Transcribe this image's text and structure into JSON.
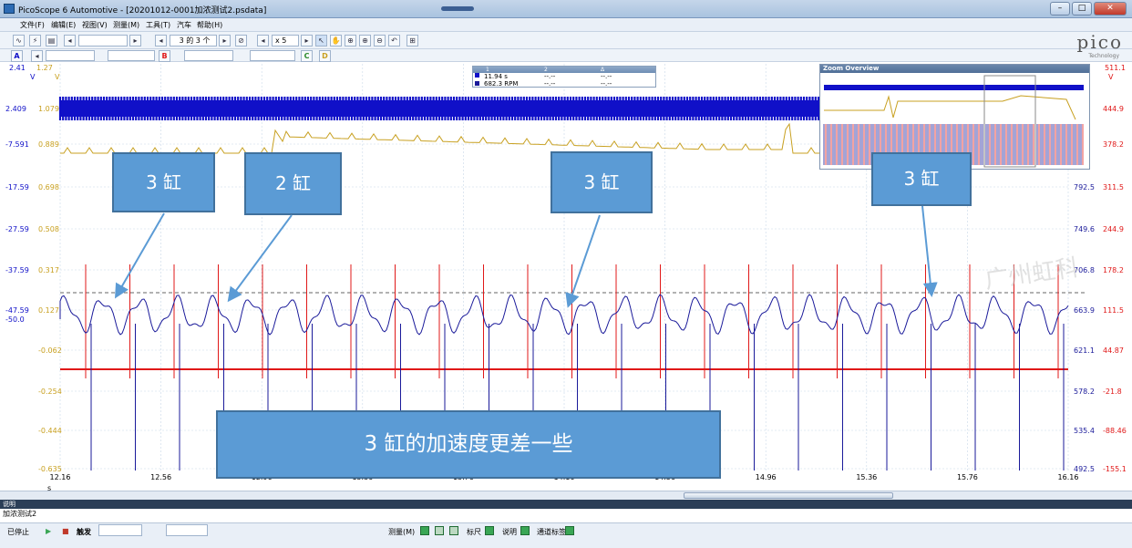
{
  "window": {
    "title": "PicoScope 6 Automotive - [20201012-0001加浓测试2.psdata]",
    "min_label": "–",
    "max_label": "□",
    "close_label": "✕"
  },
  "menu": [
    "文件(F)",
    "编辑(E)",
    "视图(V)",
    "测量(M)",
    "工具(T)",
    "汽车",
    "帮助(H)"
  ],
  "toolbar1": {
    "buffer_label": "3 的 3 个",
    "zoom_label": "x 5"
  },
  "toolbar2": {
    "channel_a": "A",
    "channel_b": "B",
    "channel_c": "C",
    "channel_d": "D"
  },
  "logo": {
    "text": "pico",
    "sub": "Technology"
  },
  "left_axis_header": {
    "a": "2.41",
    "b": "1.27",
    "unit_a": "V",
    "unit_b": "V"
  },
  "left_axis": [
    {
      "a": "2.409",
      "b": "1.079"
    },
    {
      "a": "-7.591",
      "b": "0.889"
    },
    {
      "a": "-17.59",
      "b": "0.698"
    },
    {
      "a": "-27.59",
      "b": "0.508"
    },
    {
      "a": "-37.59",
      "b": "0.317"
    },
    {
      "a": "-47.59",
      "b": "0.127"
    },
    {
      "a": "",
      "b": "-0.062"
    },
    {
      "a": "",
      "b": "-0.254"
    },
    {
      "a": "",
      "b": "-0.444"
    },
    {
      "a": "",
      "b": "-0.635"
    }
  ],
  "left_axis_extra": "-50.0",
  "right_axis_header": {
    "value": "511.1",
    "unit": "V"
  },
  "right_axis": [
    {
      "rpm": "",
      "v": "444.9"
    },
    {
      "rpm": "",
      "v": "378.2"
    },
    {
      "rpm": "792.5",
      "v": "311.5"
    },
    {
      "rpm": "749.6",
      "v": "244.9"
    },
    {
      "rpm": "706.8",
      "v": "178.2"
    },
    {
      "rpm": "663.9",
      "v": "111.5"
    },
    {
      "rpm": "621.1",
      "v": "44.87"
    },
    {
      "rpm": "578.2",
      "v": "-21.8"
    },
    {
      "rpm": "535.4",
      "v": "-88.46"
    },
    {
      "rpm": "492.5",
      "v": "-155.1"
    }
  ],
  "x_axis": {
    "ticks": [
      "12.16",
      "12.56",
      "12.96",
      "13.36",
      "13.76",
      "14.16",
      "14.56",
      "14.96",
      "15.36",
      "15.76",
      "16.16"
    ],
    "unit": "s"
  },
  "measure_box": {
    "col1": "1",
    "col2": "2",
    "col3": "Δ",
    "row1": [
      "11.94 s",
      "--.--",
      "--.--"
    ],
    "row2": [
      "682.3 RPM",
      "--.--",
      "--.--"
    ]
  },
  "zoom_overview": {
    "title": "Zoom Overview"
  },
  "callouts": {
    "c1": "3 缸",
    "c2": "2 缸",
    "c3": "3 缸",
    "c4": "3 缸",
    "main": "3 缸的加速度更差一些"
  },
  "watermark": "广州虹科",
  "notes": {
    "header": "说明",
    "text": "加浓测试2"
  },
  "status": {
    "stopped": "已停止",
    "trigger": "触发",
    "measure": "测量(M)",
    "ruler": "标尺",
    "note": "说明",
    "channel_label": "通道标签"
  },
  "colors": {
    "blue": "#1010c8",
    "gold": "#c8a020",
    "red": "#e01818",
    "navy": "#1a1a9a"
  }
}
